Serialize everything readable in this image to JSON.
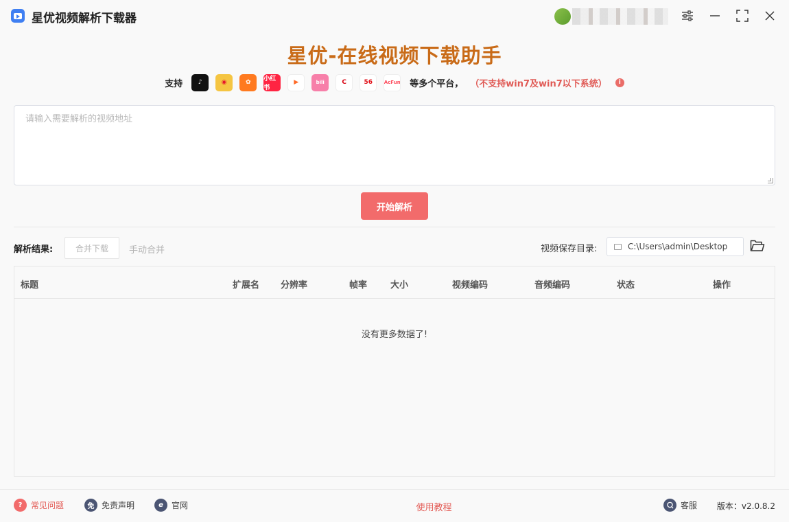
{
  "window": {
    "app_title": "星优视频解析下载器",
    "controls": [
      "settings-icon",
      "minimize-icon",
      "maximize-icon",
      "close-icon"
    ]
  },
  "header": {
    "headline": "星优-在线视频下载助手",
    "support_label": "支持",
    "platforms": [
      {
        "name": "tiktok-icon",
        "glyph": "♪",
        "bg": "#111111",
        "fg": "#ffffff"
      },
      {
        "name": "weibo-icon",
        "glyph": "◉",
        "bg": "#f5c542",
        "fg": "#e6162d"
      },
      {
        "name": "kuaishou-icon",
        "glyph": "✿",
        "bg": "#ff7a1f",
        "fg": "#ffffff"
      },
      {
        "name": "xiaohongshu-icon",
        "glyph": "小红书",
        "bg": "#ff2442",
        "fg": "#ffffff"
      },
      {
        "name": "tencent-video-icon",
        "glyph": "▶",
        "bg": "#ffffff",
        "fg": "#ff6a28"
      },
      {
        "name": "bilibili-icon",
        "glyph": "bili",
        "bg": "#f77fa9",
        "fg": "#ffffff"
      },
      {
        "name": "cctv-icon",
        "glyph": "C",
        "bg": "#ffffff",
        "fg": "#d7000f"
      },
      {
        "name": "56-icon",
        "glyph": "56",
        "bg": "#ffffff",
        "fg": "#e2141c"
      },
      {
        "name": "acfun-icon",
        "glyph": "AcFun",
        "bg": "#ffffff",
        "fg": "#fd4c5d"
      }
    ],
    "more_label": "等多个平台，",
    "warning_label": "（不支持win7及win7以下系统）",
    "info_glyph": "i"
  },
  "input": {
    "placeholder": "请输入需要解析的视频地址"
  },
  "actions": {
    "parse_button": "开始解析"
  },
  "results": {
    "label": "解析结果:",
    "merge_download": "合并下载",
    "manual_merge": "手动合并",
    "save_dir_label": "视频保存目录:",
    "save_dir_value": "C:\\Users\\admin\\Desktop",
    "columns": [
      "标题",
      "扩展名",
      "分辨率",
      "帧率",
      "大小",
      "视频编码",
      "音频编码",
      "状态",
      "操作"
    ],
    "empty_message": "没有更多数据了!"
  },
  "footer": {
    "faq": "常见问题",
    "disclaimer": "免责声明",
    "website": "官网",
    "tutorial": "使用教程",
    "support": "客服",
    "version": "版本：v2.0.8.2",
    "faq_glyph": "?",
    "disclaimer_glyph": "免",
    "website_glyph": "e"
  },
  "colors": {
    "accent_red": "#f26b6b",
    "headline_orange": "#c96b18",
    "warning_red": "#e05a55"
  }
}
